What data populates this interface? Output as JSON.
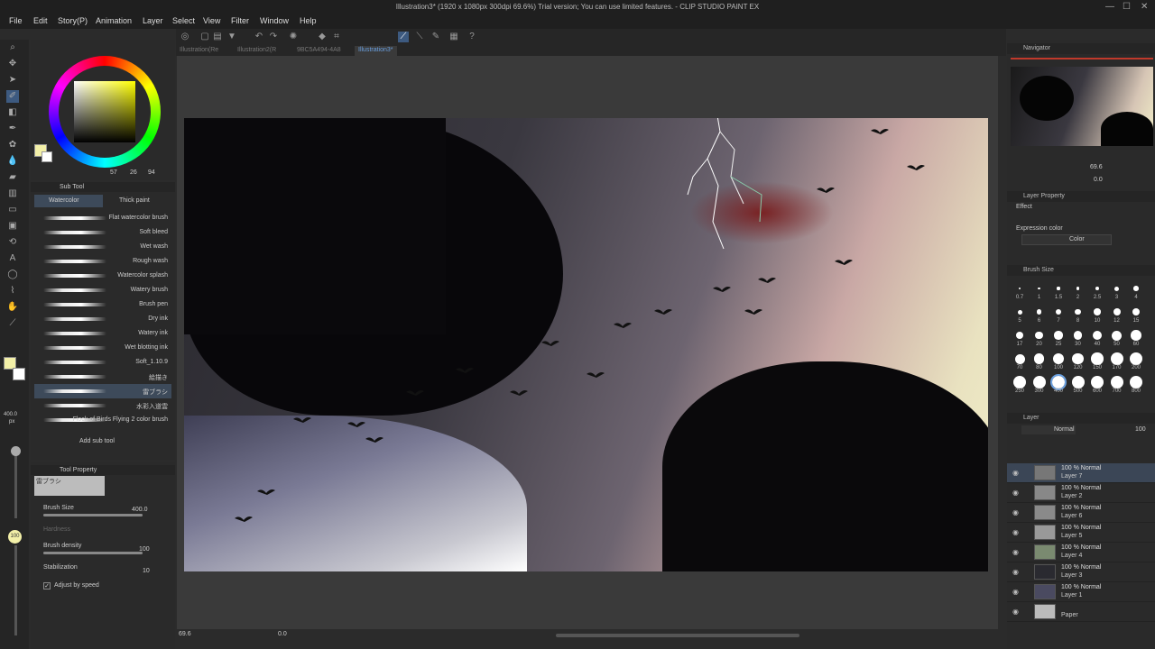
{
  "window": {
    "title": "Illustration3* (1920 x 1080px 300dpi 69.6%)  Trial version; You can use limited features. - CLIP STUDIO PAINT EX"
  },
  "menu": [
    "File",
    "Edit",
    "Story(P)",
    "Animation",
    "Layer",
    "Select",
    "View",
    "Filter",
    "Window",
    "Help"
  ],
  "tabs": [
    {
      "label": "Illustration(Re",
      "active": false
    },
    {
      "label": "Illustration2(R",
      "active": false
    },
    {
      "label": "9BC5A494-4A8",
      "active": false
    },
    {
      "label": "Illustration3*",
      "active": true
    }
  ],
  "color_panel": {
    "values": [
      "57",
      "26",
      "94"
    ],
    "main_color": "#f3f0a8",
    "sub_color": "#ffffff"
  },
  "subtool": {
    "header": "Sub Tool",
    "groups": [
      "Watercolor",
      "Thick paint"
    ],
    "items": [
      "Flat watercolor brush",
      "Soft bleed",
      "Wet wash",
      "Rough wash",
      "Watercolor splash",
      "Watery brush",
      "Brush pen",
      "Dry ink",
      "Watery ink",
      "Wet blotting ink",
      "Soft_1.10.9",
      "絵描き",
      "雷ブラシ",
      "水彩入道雲",
      "Flock of Birds Flying 2 color brush"
    ],
    "selected_index": 12,
    "add_label": "Add sub tool"
  },
  "tool_property": {
    "header": "Tool Property",
    "preview_name": "雷ブラシ",
    "brush_size_label": "Brush Size",
    "brush_size_value": "400.0",
    "hardness_label": "Hardness",
    "density_label": "Brush density",
    "density_value": "100",
    "stabilization_label": "Stabilization",
    "stabilization_value": "10",
    "adjust_label": "Adjust by speed",
    "adjust_checked": true
  },
  "left_size": {
    "value": "400.0",
    "unit": "px",
    "opacity": "100"
  },
  "navigator": {
    "header": "Navigator",
    "zoom": "69.6",
    "rotate": "0.0"
  },
  "layer_property": {
    "header": "Layer Property",
    "effect_label": "Effect",
    "expression_label": "Expression color",
    "expression_value": "Color"
  },
  "brush_size_panel": {
    "header": "Brush Size",
    "sizes": [
      "0.7",
      "1",
      "1.5",
      "2",
      "2.5",
      "3",
      "4",
      "5",
      "6",
      "7",
      "8",
      "10",
      "12",
      "15",
      "17",
      "20",
      "25",
      "30",
      "40",
      "50",
      "60",
      "70",
      "80",
      "100",
      "120",
      "150",
      "170",
      "200",
      "250",
      "300",
      "400",
      "500",
      "600",
      "700",
      "800"
    ],
    "selected": "400"
  },
  "layer_panel": {
    "header": "Layer",
    "blend": "Normal",
    "opacity": "100",
    "layers": [
      {
        "mode": "100 % Normal",
        "name": "Layer 7",
        "selected": true
      },
      {
        "mode": "100 % Normal",
        "name": "Layer 2",
        "selected": false
      },
      {
        "mode": "100 % Normal",
        "name": "Layer 6",
        "selected": false
      },
      {
        "mode": "100 % Normal",
        "name": "Layer 5",
        "selected": false
      },
      {
        "mode": "100 % Normal",
        "name": "Layer 4",
        "selected": false
      },
      {
        "mode": "100 % Normal",
        "name": "Layer 3",
        "selected": false
      },
      {
        "mode": "100 % Normal",
        "name": "Layer 1",
        "selected": false
      },
      {
        "mode": "",
        "name": "Paper",
        "selected": false
      }
    ]
  },
  "status": {
    "zoom": "69.6",
    "rotation": "0.0"
  }
}
